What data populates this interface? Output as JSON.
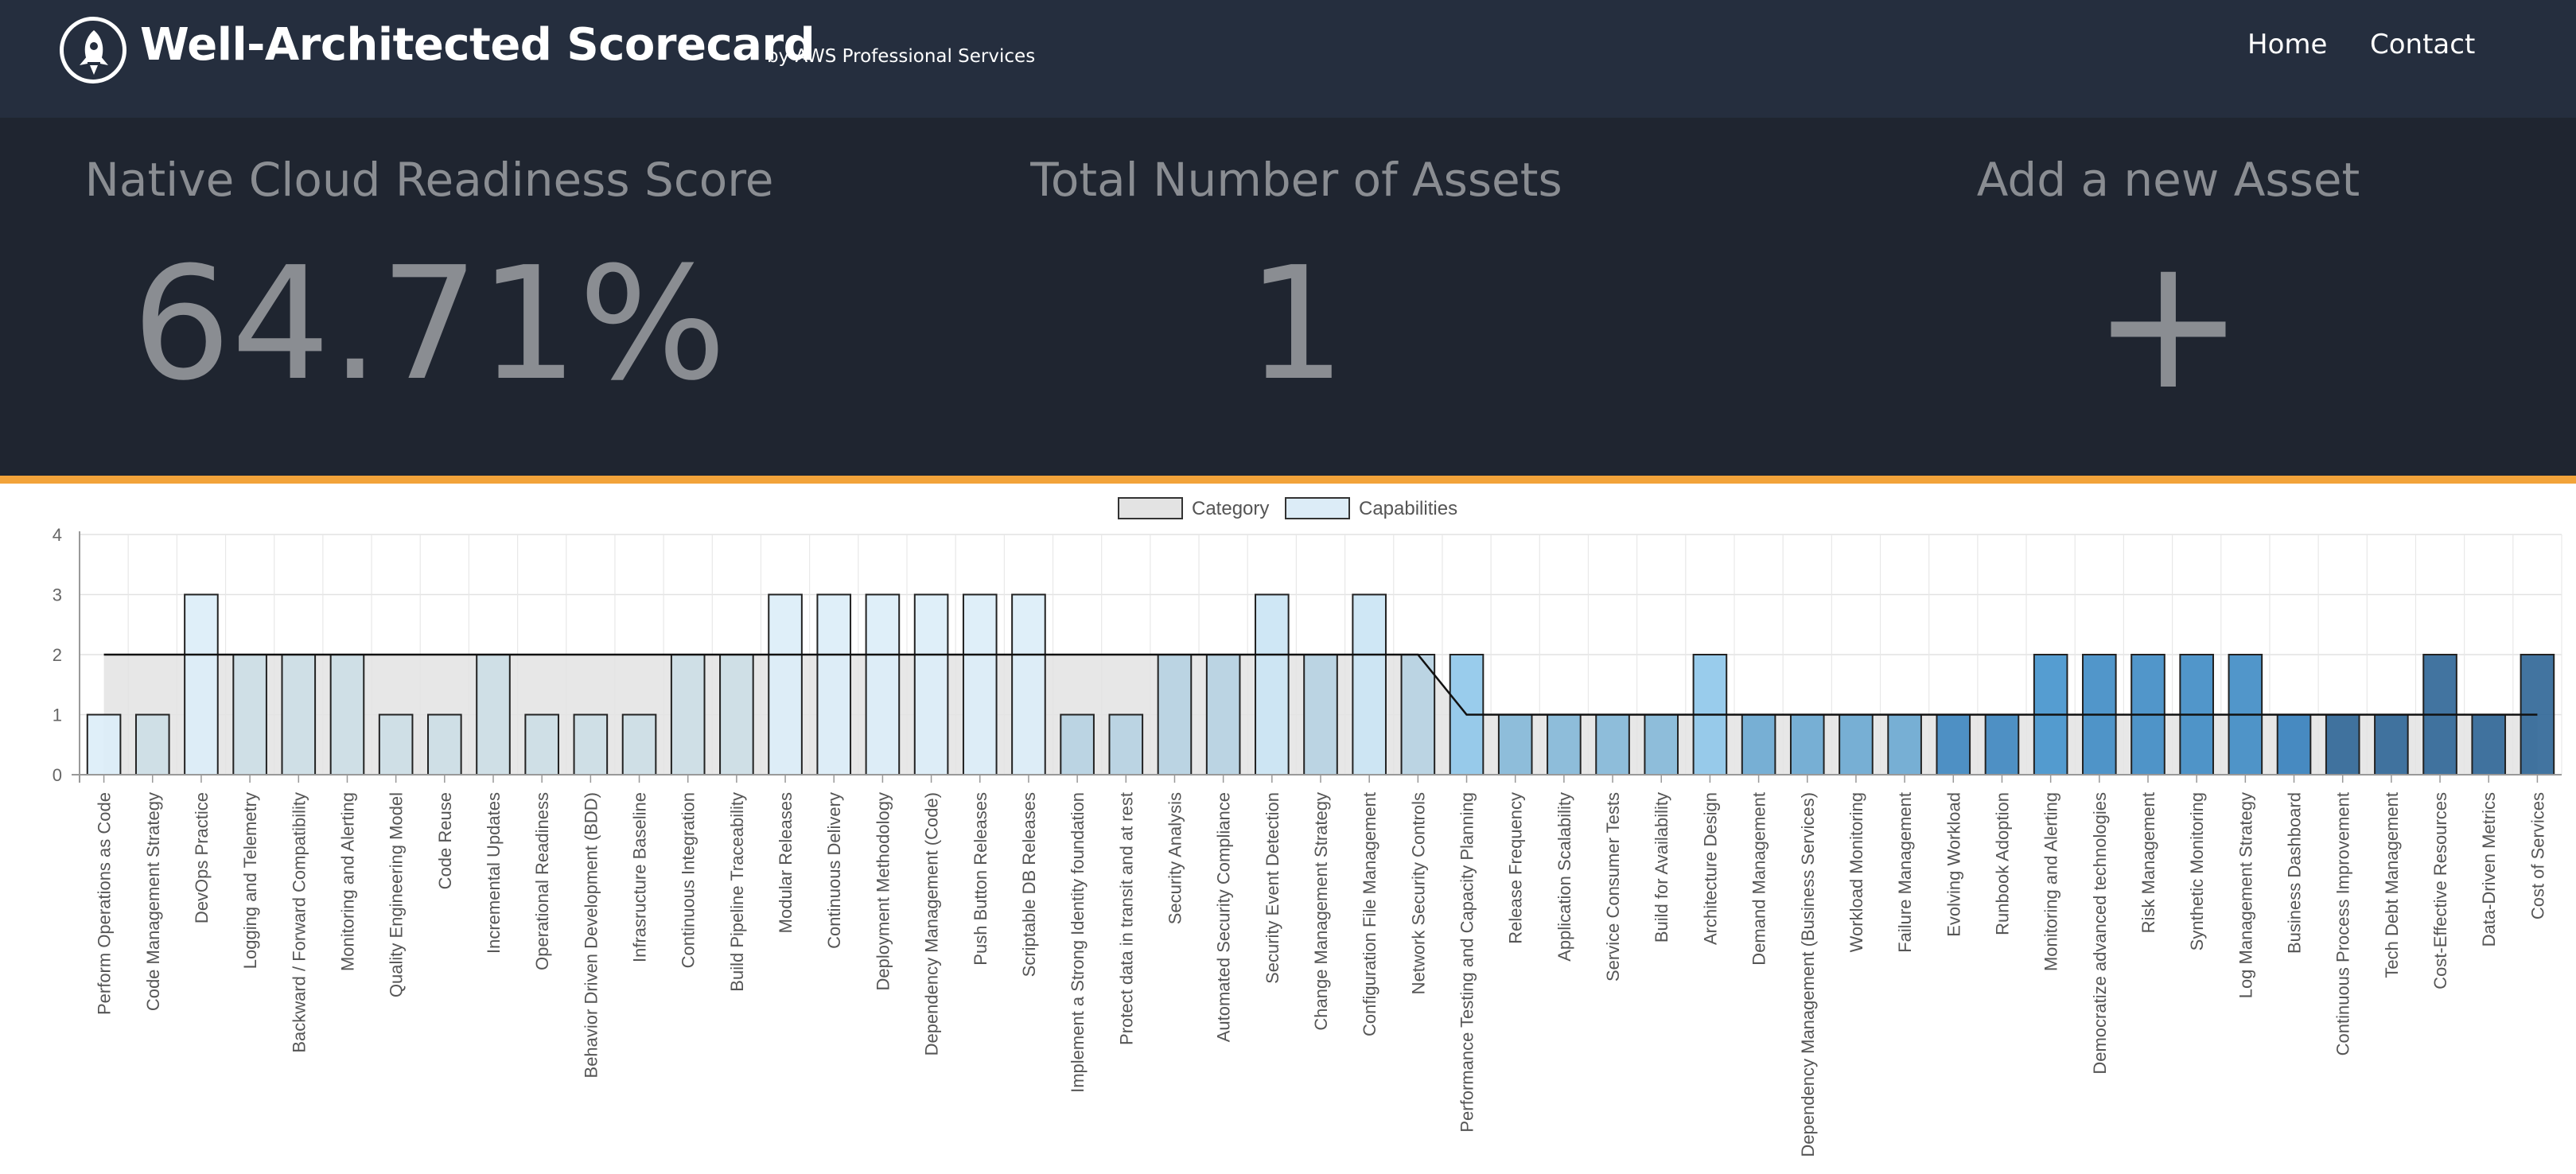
{
  "header": {
    "title": "Well-Architected Scorecard",
    "subtitle": "by AWS Professional Services",
    "logo_icon": "rocket-icon",
    "nav": {
      "home": "Home",
      "contact": "Contact"
    }
  },
  "stats": {
    "readiness": {
      "label": "Native Cloud Readiness Score",
      "value": "64.71%"
    },
    "assets": {
      "label": "Total Number of Assets",
      "value": "1"
    },
    "add_asset": {
      "label": "Add a new Asset",
      "value": "+"
    }
  },
  "colors": {
    "nav_bg": "#252e3e",
    "hero_bg": "#1f2530",
    "accent": "#f2a33a",
    "stat_text": "#8a8d92"
  },
  "chart_data": {
    "type": "bar",
    "legend": [
      {
        "name": "Category",
        "color": "#e3e3e3"
      },
      {
        "name": "Capabilities",
        "color": "#dcecf7"
      }
    ],
    "legend_position": "top-center",
    "ylim": [
      0,
      4
    ],
    "yticks": [
      0,
      1,
      2,
      3,
      4
    ],
    "grid": true,
    "categories": [
      "Perform Operations as Code",
      "Code Management Strategy",
      "DevOps Practice",
      "Logging and Telemetry",
      "Backward / Forward Compatibility",
      "Monitoring and Alerting",
      "Quality Engineering Model",
      "Code Reuse",
      "Incremental Updates",
      "Operational Readiness",
      "Behavior Driven Development (BDD)",
      "Infrasructure Baseline",
      "Continuous Integration",
      "Build Pipeline Traceability",
      "Modular Releases",
      "Continuous Delivery",
      "Deployment Methodology",
      "Dependency Management (Code)",
      "Push Button Releases",
      "Scriptable DB Releases",
      "Implement a Strong Identity foundation",
      "Protect data in transit and at rest",
      "Security Analysis",
      "Automated Security Compliance",
      "Security Event Detection",
      "Change Management Strategy",
      "Configuration File Management",
      "Network Security Controls",
      "Performance Testing and Capacity Planning",
      "Release Frequency",
      "Application Scalability",
      "Service Consumer Tests",
      "Build for Availability",
      "Architecture Design",
      "Demand Management",
      "Dependency Management (Business Services)",
      "Workload Monitoring",
      "Failure Management",
      "Evolving Workload",
      "Runbook Adoption",
      "Monitoring and Alerting",
      "Democratize advanced technologies",
      "Risk Management",
      "Synthetic Monitoring",
      "Log Management Strategy",
      "Business Dashboard",
      "Continuous Process Improvement",
      "Tech Debt Management",
      "Cost-Effective Resources",
      "Data-Driven Metrics",
      "Cost of Services"
    ],
    "series": [
      {
        "name": "Capabilities",
        "type": "bar",
        "values": [
          1,
          1,
          3,
          2,
          2,
          2,
          1,
          1,
          2,
          1,
          1,
          1,
          2,
          2,
          3,
          3,
          3,
          3,
          3,
          3,
          1,
          1,
          2,
          2,
          3,
          2,
          3,
          2,
          2,
          1,
          1,
          1,
          1,
          2,
          1,
          1,
          1,
          1,
          1,
          1,
          2,
          2,
          2,
          2,
          2,
          1,
          1,
          1,
          2,
          1,
          2
        ],
        "colors": [
          "#dcedf8",
          "#ccdee6",
          "#dcedf8",
          "#ccdee6",
          "#ccdee6",
          "#ccdee6",
          "#ccdee6",
          "#ccdee6",
          "#ccdee6",
          "#ccdee6",
          "#ccdee6",
          "#ccdee6",
          "#ccdee6",
          "#ccdee6",
          "#dcedf8",
          "#dcedf8",
          "#dcedf8",
          "#dcedf8",
          "#dcedf8",
          "#dcedf8",
          "#b6d2e2",
          "#b6d2e2",
          "#b6d2e2",
          "#b6d2e2",
          "#cae4f4",
          "#b6d2e2",
          "#cae4f4",
          "#b6d2e2",
          "#8ec7ea",
          "#84b8d8",
          "#84b8d8",
          "#84b8d8",
          "#84b8d8",
          "#8ec7ea",
          "#6aa8d2",
          "#6aa8d2",
          "#6aa8d2",
          "#6aa8d2",
          "#3d86c0",
          "#3d86c0",
          "#4292cc",
          "#3e8bc4",
          "#3e8bc4",
          "#3e8bc4",
          "#3e8bc4",
          "#3580bd",
          "#2e6596",
          "#2e6596",
          "#2e6596",
          "#2e6596",
          "#2e6596"
        ]
      },
      {
        "name": "Category",
        "type": "line",
        "values": [
          2,
          2,
          2,
          2,
          2,
          2,
          2,
          2,
          2,
          2,
          2,
          2,
          2,
          2,
          2,
          2,
          2,
          2,
          2,
          2,
          2,
          2,
          2,
          2,
          2,
          2,
          2,
          2,
          1,
          1,
          1,
          1,
          1,
          1,
          1,
          1,
          1,
          1,
          1,
          1,
          1,
          1,
          1,
          1,
          1,
          1,
          1,
          1,
          1,
          1,
          1
        ]
      }
    ]
  }
}
